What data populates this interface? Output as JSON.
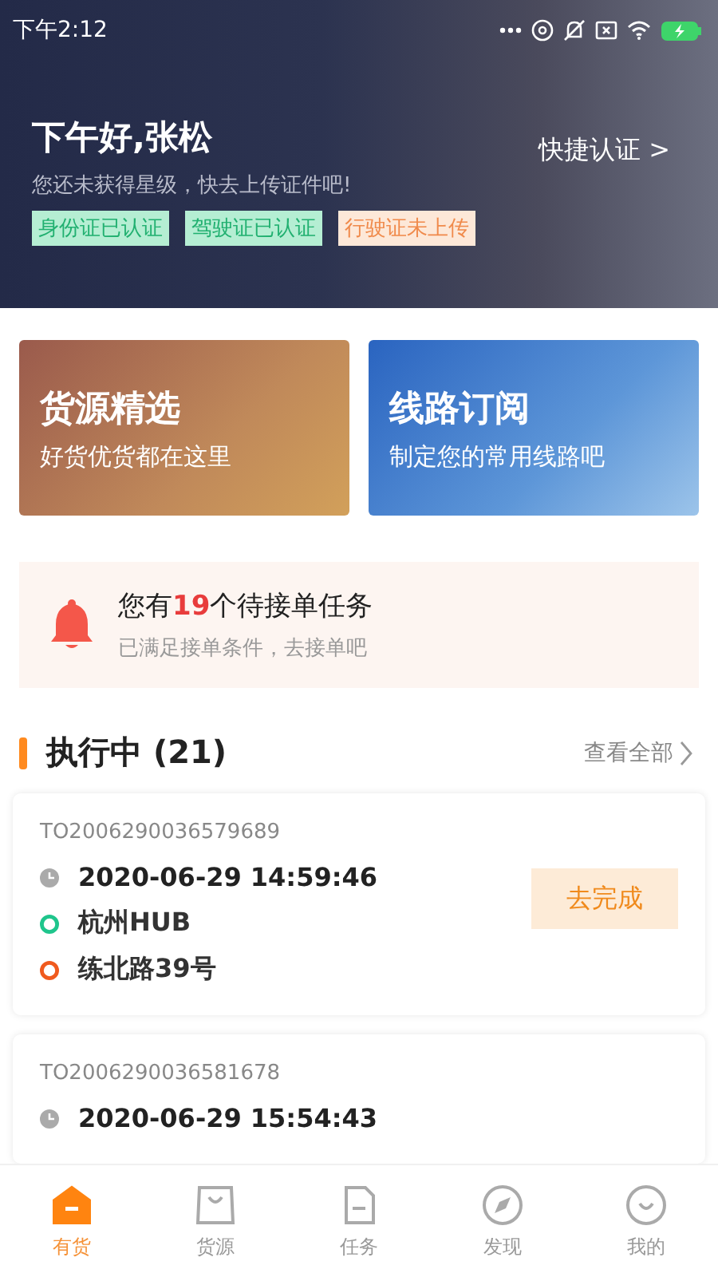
{
  "status_bar": {
    "time": "下午2:12"
  },
  "header": {
    "greeting": "下午好,张松",
    "hint": "您还未获得星级，快去上传证件吧!",
    "quick_auth": "快捷认证 >",
    "tags": [
      {
        "label": "身份证已认证",
        "verified": true
      },
      {
        "label": "驾驶证已认证",
        "verified": true
      },
      {
        "label": "行驶证未上传",
        "verified": false
      }
    ]
  },
  "promos": [
    {
      "kind": "goods",
      "title": "货源精选",
      "subtitle": "好货优货都在这里"
    },
    {
      "kind": "route",
      "title": "线路订阅",
      "subtitle": "制定您的常用线路吧"
    }
  ],
  "notice": {
    "title": "您有**19**个待接单任务",
    "subtitle": "已满足接单条件，去接单吧"
  },
  "section": {
    "title": "执行中 (21)",
    "view_all": "查看全部"
  },
  "orders": [
    {
      "number": "TO2006290036579689",
      "time": "2020-06-29 14:59:46",
      "origin": "杭州HUB",
      "destination": "练北路39号",
      "action": "去完成"
    },
    {
      "number": "TO2006290036581678",
      "time": "2020-06-29 15:54:43"
    }
  ],
  "tab_bar": [
    {
      "label": "有货",
      "kind": "home",
      "selected": true
    },
    {
      "label": "货源",
      "kind": "bag",
      "selected": false
    },
    {
      "label": "任务",
      "kind": "doc",
      "selected": false
    },
    {
      "label": "发现",
      "kind": "compass",
      "selected": false
    },
    {
      "label": "我的",
      "kind": "smile",
      "selected": false
    }
  ]
}
